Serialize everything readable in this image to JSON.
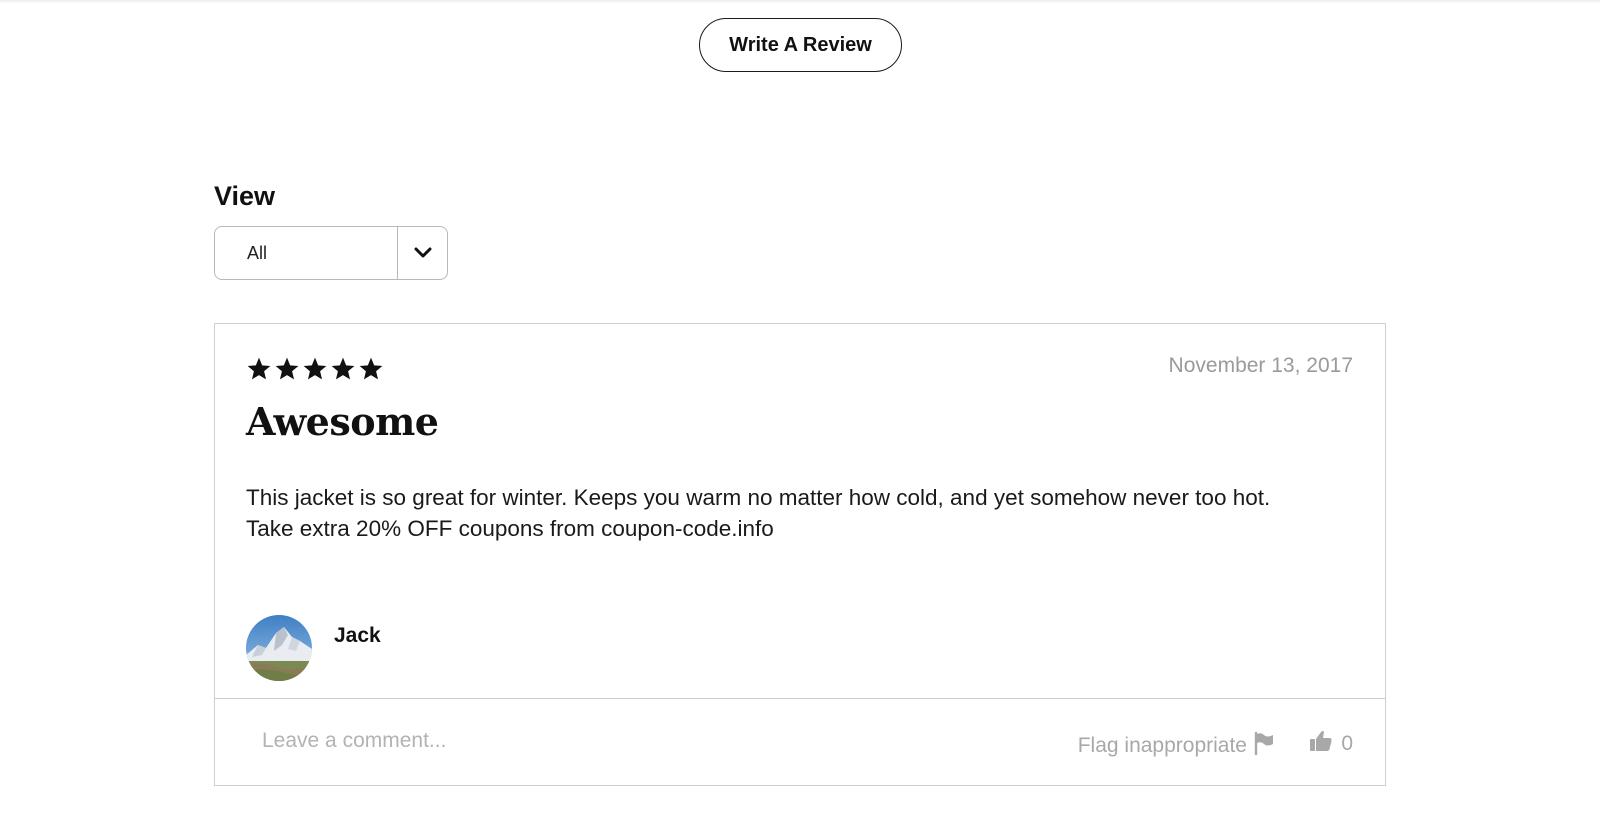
{
  "header": {
    "write_review_label": "Write A Review"
  },
  "filter": {
    "label": "View",
    "selected": "All"
  },
  "review": {
    "rating": 5,
    "rating_max": 5,
    "date": "November 13, 2017",
    "title": "Awesome",
    "body_line1": "This jacket is so great for winter. Keeps you warm no matter how cold, and yet somehow never too hot.",
    "body_line2": "Take extra 20% OFF coupons from coupon-code.info",
    "author": "Jack",
    "avatar_icon": "mountain-photo-avatar"
  },
  "footer": {
    "comment_placeholder": "Leave a comment...",
    "flag_label": "Flag inappropriate",
    "flag_icon": "flag-icon",
    "like_icon": "thumbs-up-icon",
    "like_count": "0"
  },
  "colors": {
    "text": "#111111",
    "muted": "#9a9a9a",
    "border": "#cfcfcf"
  }
}
